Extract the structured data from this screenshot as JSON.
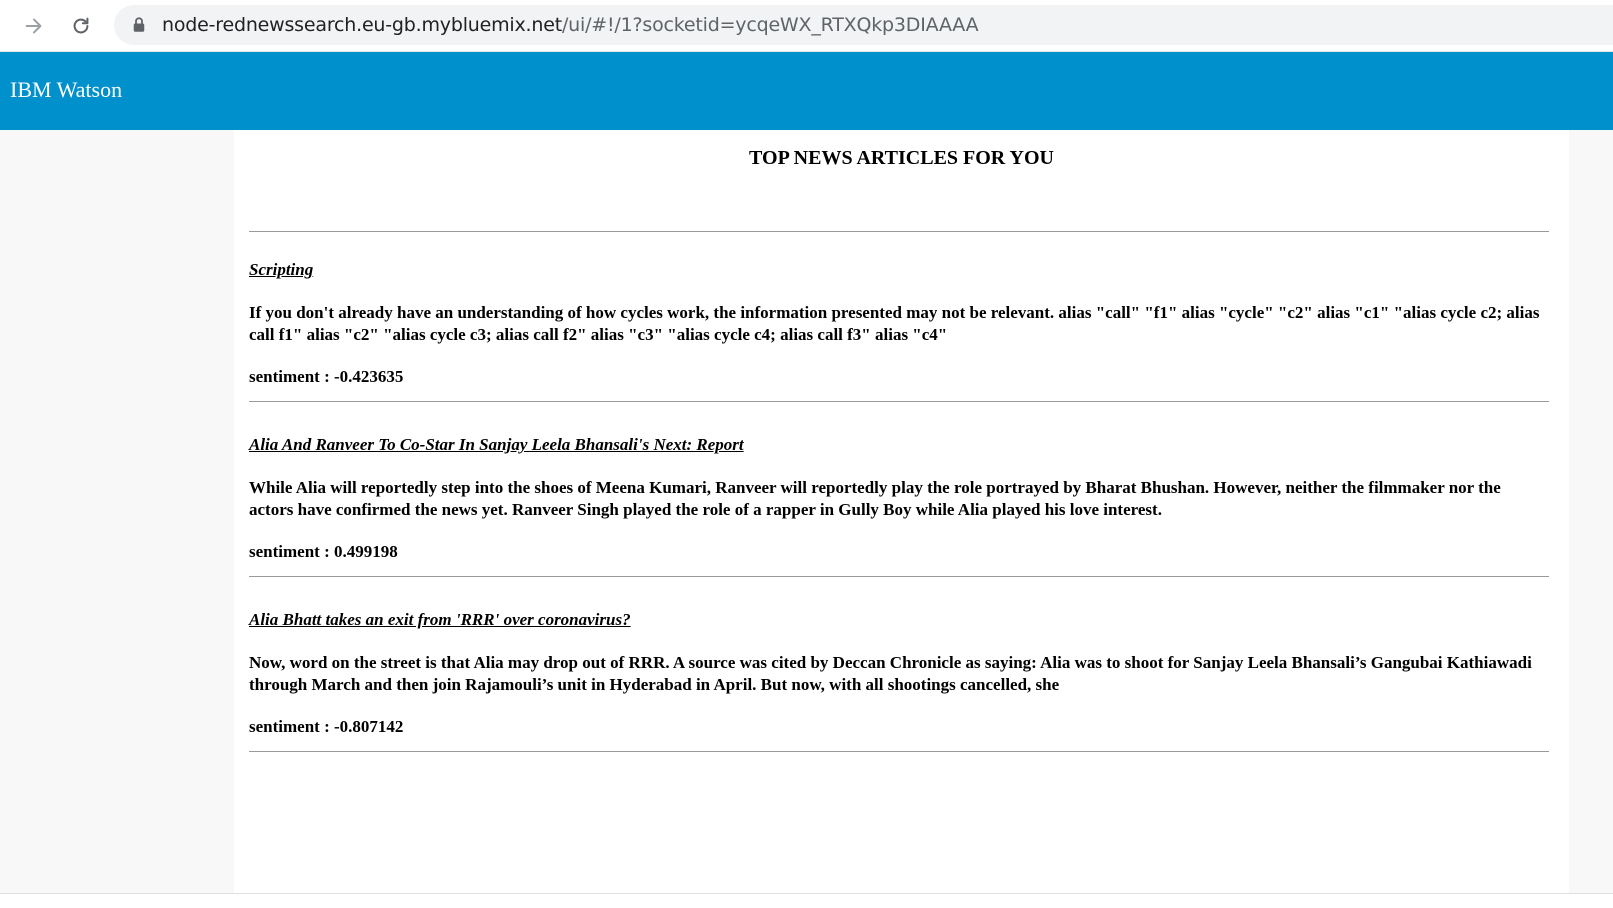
{
  "browser": {
    "url_host": "node-rednewssearch.eu-gb.mybluemix.net",
    "url_path": "/ui/#!/1?socketid=ycqeWX_RTXQkp3DIAAAA"
  },
  "header": {
    "title": "IBM Watson",
    "color": "#0091cd"
  },
  "content": {
    "title": "TOP NEWS ARTICLES FOR YOU",
    "sentiment_label": "sentiment : ",
    "articles": [
      {
        "title": "Scripting",
        "description": "If you don't already have an understanding of how cycles work, the information presented may not be relevant. alias \"call\" \"f1\" alias \"cycle\" \"c2\" alias \"c1\" \"alias cycle c2; alias call f1\" alias \"c2\" \"alias cycle c3; alias call f2\" alias \"c3\" \"alias cycle c4; alias call f3\" alias \"c4\"",
        "sentiment": "sentiment : -0.423635"
      },
      {
        "title": "Alia And Ranveer To Co-Star In Sanjay Leela Bhansali's Next: Report",
        "description": "While Alia will reportedly step into the shoes of Meena Kumari, Ranveer will reportedly play the role portrayed by Bharat Bhushan. However, neither the filmmaker nor the actors have confirmed the news yet. Ranveer Singh played the role of a rapper in Gully Boy while Alia played his love interest.",
        "sentiment": "sentiment : 0.499198"
      },
      {
        "title": "Alia Bhatt takes an exit from 'RRR' over coronavirus?",
        "description": "Now, word on the street is that Alia may drop out of RRR. A source was cited by Deccan Chronicle as saying: Alia was to shoot for Sanjay Leela Bhansali’s Gangubai Kathiawadi through March and then join Rajamouli’s unit in Hyderabad in April. But now, with all shootings cancelled, she",
        "sentiment": "sentiment : -0.807142"
      }
    ]
  }
}
